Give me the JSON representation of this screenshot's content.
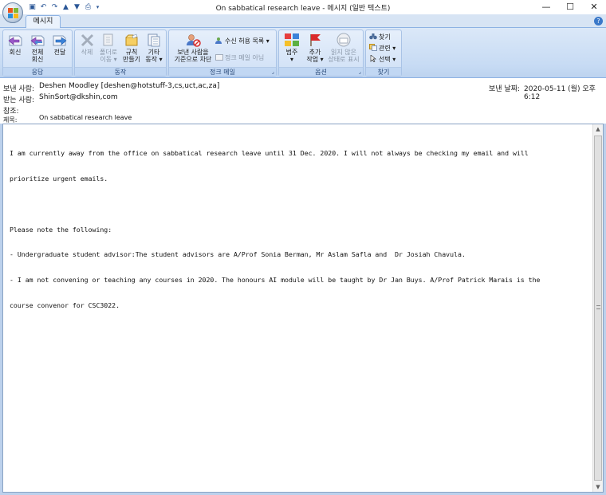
{
  "window": {
    "title": "On sabbatical research leave - 메시지 (일반 텍스트)",
    "minimize": "—",
    "maximize": "☐",
    "close": "✕"
  },
  "ribbon": {
    "active_tab": "메시지",
    "groups": {
      "respond": {
        "label": "응답",
        "reply": "회신",
        "reply_all_1": "전체",
        "reply_all_2": "회신",
        "forward": "전달"
      },
      "actions": {
        "label": "동작",
        "delete": "삭제",
        "move_1": "폴더로",
        "move_2": "이동 ▾",
        "rules_1": "규칙",
        "rules_2": "만들기",
        "other_1": "기타",
        "other_2": "동작 ▾"
      },
      "junk": {
        "label": "정크 메일",
        "block_1": "보낸 사람을",
        "block_2": "기준으로 차단",
        "safe_list": "수신 허용 목록 ▾",
        "not_junk": "정크 메일 아님"
      },
      "options": {
        "label": "옵션",
        "categorize": "범주",
        "categorize_arrow": "▾",
        "followup_1": "추가",
        "followup_2": "작업 ▾",
        "unread_1": "읽지 않은",
        "unread_2": "상태로 표시"
      },
      "find": {
        "label": "찾기",
        "find": "찾기",
        "related": "관련 ▾",
        "select": "선택 ▾"
      }
    }
  },
  "header": {
    "from_label": "보낸 사람:",
    "from_value": "Deshen Moodley [deshen@hotstuff-3,cs,uct,ac,za]",
    "to_label": "받는 사람:",
    "to_value": "ShinSort@dkshin,com",
    "cc_label": "참조:",
    "cc_value": "",
    "subject_label": "제목:",
    "subject_value": "On sabbatical research leave",
    "sent_label": "보낸 날짜:",
    "sent_value": "2020-05-11 (월) 오후 6:12"
  },
  "message": {
    "lines": [
      "I am currently away from the office on sabbatical research leave until 31 Dec. 2020. I will not always be checking my email and will",
      "prioritize urgent emails.",
      "",
      "Please note the following:",
      "- Undergraduate student advisor:The student advisors are A/Prof Sonia Berman, Mr Aslam Safla and  Dr Josiah Chavula.",
      "- I am not convening or teaching any courses in 2020. The honours AI module will be taught by Dr Jan Buys. A/Prof Patrick Marais is the",
      "course convenor for CSC3022."
    ]
  },
  "colors": {
    "ribbon_blue": "#c7dbf4",
    "accent": "#2b5797"
  }
}
